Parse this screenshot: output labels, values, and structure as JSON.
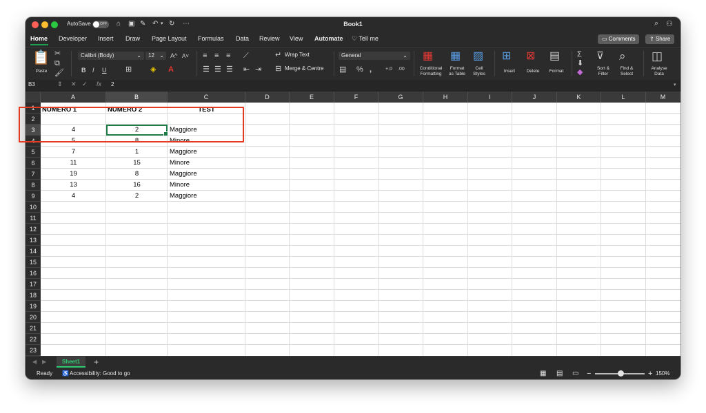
{
  "window": {
    "title": "Book1",
    "autosave_label": "AutoSave",
    "autosave_state": "OFF"
  },
  "tabs": [
    "Home",
    "Developer",
    "Insert",
    "Draw",
    "Page Layout",
    "Formulas",
    "Data",
    "Review",
    "View",
    "Automate"
  ],
  "tell_me": "Tell me",
  "comments_label": "Comments",
  "share_label": "Share",
  "ribbon": {
    "paste": "Paste",
    "font": "Calibri (Body)",
    "font_size": "12",
    "wrap_text": "Wrap Text",
    "merge_centre": "Merge & Centre",
    "number_format": "General",
    "conditional_formatting": [
      "Conditional",
      "Formatting"
    ],
    "format_as_table": [
      "Format",
      "as Table"
    ],
    "cell_styles": [
      "Cell",
      "Styles"
    ],
    "insert": "Insert",
    "delete": "Delete",
    "format": "Format",
    "sort_filter": [
      "Sort &",
      "Filter"
    ],
    "find_select": [
      "Find &",
      "Select"
    ],
    "analyse_data": [
      "Analyse",
      "Data"
    ]
  },
  "formula_bar": {
    "name_box": "B3",
    "fx": "fx",
    "content": "2"
  },
  "columns": [
    "A",
    "B",
    "C",
    "D",
    "E",
    "F",
    "G",
    "H",
    "I",
    "J",
    "K",
    "L",
    "M"
  ],
  "rows": [
    "1",
    "2",
    "3",
    "4",
    "5",
    "6",
    "7",
    "8",
    "9",
    "10",
    "11",
    "12",
    "13",
    "14",
    "15",
    "16",
    "17",
    "18",
    "19",
    "20",
    "21",
    "22",
    "23"
  ],
  "headers": {
    "a": "NUMERO 1",
    "b": "NUMERO 2",
    "c": "TEST"
  },
  "data_rows": [
    {
      "a": "4",
      "b": "2",
      "c": "Maggiore"
    },
    {
      "a": "5",
      "b": "8",
      "c": "Minore"
    },
    {
      "a": "7",
      "b": "1",
      "c": "Maggiore"
    },
    {
      "a": "11",
      "b": "15",
      "c": "Minore"
    },
    {
      "a": "19",
      "b": "8",
      "c": "Maggiore"
    },
    {
      "a": "13",
      "b": "16",
      "c": "Minore"
    },
    {
      "a": "4",
      "b": "2",
      "c": "Maggiore"
    }
  ],
  "sheet_tab": "Sheet1",
  "status": {
    "ready": "Ready",
    "accessibility": "Accessibility: Good to go",
    "zoom": "150%"
  },
  "colors": {
    "accent": "#1e7b45",
    "highlight": "#e33b22",
    "sheet_tab": "#2ecc71"
  }
}
